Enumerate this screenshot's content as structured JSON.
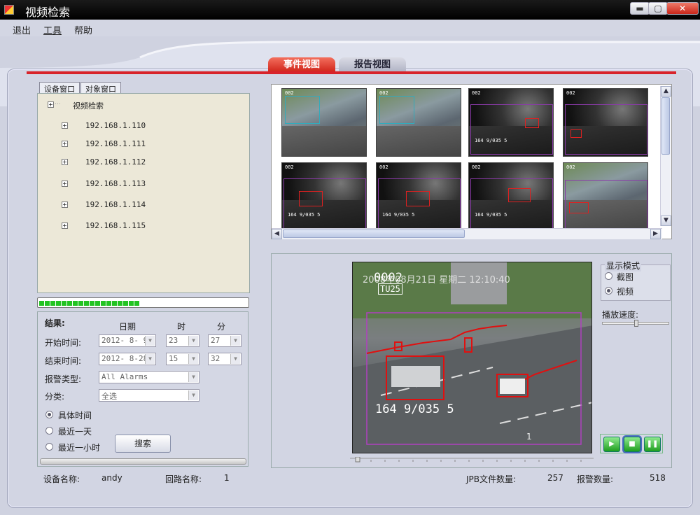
{
  "window": {
    "title": "视频检索",
    "min_label": "▬",
    "max_label": "▢",
    "close_label": "✕"
  },
  "menu": {
    "items": [
      "退出",
      "工具",
      "帮助"
    ]
  },
  "tabs": {
    "event": "事件视图",
    "report": "报告视图"
  },
  "left_tabs": {
    "device": "设备窗口",
    "object": "对象窗口"
  },
  "tree": {
    "root": "视频检索",
    "items": [
      "192.168.1.110",
      "192.168.1.111",
      "192.168.1.112",
      "192.168.1.113",
      "192.168.1.114",
      "192.168.1.115"
    ]
  },
  "progress": {
    "fraction": 0.5
  },
  "filter": {
    "results_label": "结果:",
    "col_date": "日期",
    "col_hour": "时",
    "col_minute": "分",
    "start_label": "开始时间:",
    "start_date": "2012- 8- 9",
    "start_hour": "23",
    "start_minute": "27",
    "end_label": "结束时间:",
    "end_date": "2012- 8-28",
    "end_hour": "15",
    "end_minute": "32",
    "alarm_type_label": "报警类型:",
    "alarm_type_value": "All Alarms",
    "category_label": "分类:",
    "category_value": "全选",
    "radio_specific": "具体时间",
    "radio_day": "最近一天",
    "radio_hour": "最近一小时",
    "search_label": "搜索"
  },
  "thumbnails": {
    "labels": [
      "002",
      "002",
      "002",
      "002",
      "002",
      "002",
      "002",
      "002"
    ],
    "overlay": "164 9/035 5"
  },
  "video": {
    "channel_id": "0002",
    "timestamp": "2008年08月21日 星期二 12:10:40",
    "plate": "TU25",
    "overlay": "164 9/035 5",
    "corner": "1"
  },
  "display_mode": {
    "title": "显示模式",
    "option_snapshot": "截图",
    "option_video": "视频"
  },
  "speed": {
    "label": "播放速度:",
    "level": 0.5
  },
  "controls": {
    "play": "▶",
    "stop": "■",
    "pause": "❚❚"
  },
  "status": {
    "device_label": "设备名称:",
    "device_value": "andy",
    "loop_label": "回路名称:",
    "loop_value": "1",
    "jpb_label": "JPB文件数量:",
    "jpb_value": "257",
    "alarm_label": "报警数量:",
    "alarm_value": "518"
  }
}
